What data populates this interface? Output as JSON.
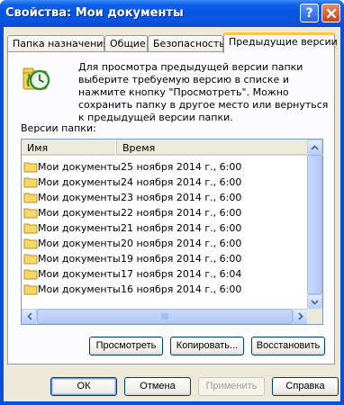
{
  "window": {
    "title": "Свойства: Мои документы",
    "help_button": "?",
    "close_button": "close-icon"
  },
  "tabs": [
    {
      "label": "Папка назначения",
      "active": false
    },
    {
      "label": "Общие",
      "active": false
    },
    {
      "label": "Безопасность",
      "active": false
    },
    {
      "label": "Предыдущие версии",
      "active": true
    }
  ],
  "panel": {
    "icon": "clock-folder-icon",
    "description": "Для просмотра предыдущей версии папки выберите требуемую версию в списке и нажмите кнопку \"Просмотреть\".  Можно сохранить папку в другое место или вернуться к предыдущей версии папки.",
    "versions_label": "Версии папки:",
    "columns": {
      "name": "Имя",
      "time": "Время"
    },
    "rows": [
      {
        "name": "Мои документы",
        "time": "25 ноября 2014 г., 6:00"
      },
      {
        "name": "Мои документы",
        "time": "24 ноября 2014 г., 6:00"
      },
      {
        "name": "Мои документы",
        "time": "23 ноября 2014 г., 6:00"
      },
      {
        "name": "Мои документы",
        "time": "22 ноября 2014 г., 6:00"
      },
      {
        "name": "Мои документы",
        "time": "21 ноября 2014 г., 6:00"
      },
      {
        "name": "Мои документы",
        "time": "20 ноября 2014 г., 6:00"
      },
      {
        "name": "Мои документы",
        "time": "19 ноября 2014 г., 6:00"
      },
      {
        "name": "Мои документы",
        "time": "17 ноября 2014 г., 6:04"
      },
      {
        "name": "Мои документы",
        "time": "16 ноября 2014 г., 6:00"
      }
    ],
    "buttons": {
      "view": "Просмотреть",
      "copy": "Копировать...",
      "restore": "Восстановить"
    }
  },
  "footer": {
    "ok": "ОК",
    "cancel": "Отмена",
    "apply": "Применить",
    "help": "Справка"
  },
  "colors": {
    "title_bar": "#0554e0",
    "active_tab_accent": "#ffc83c",
    "dialog_bg": "#ece9d8"
  }
}
